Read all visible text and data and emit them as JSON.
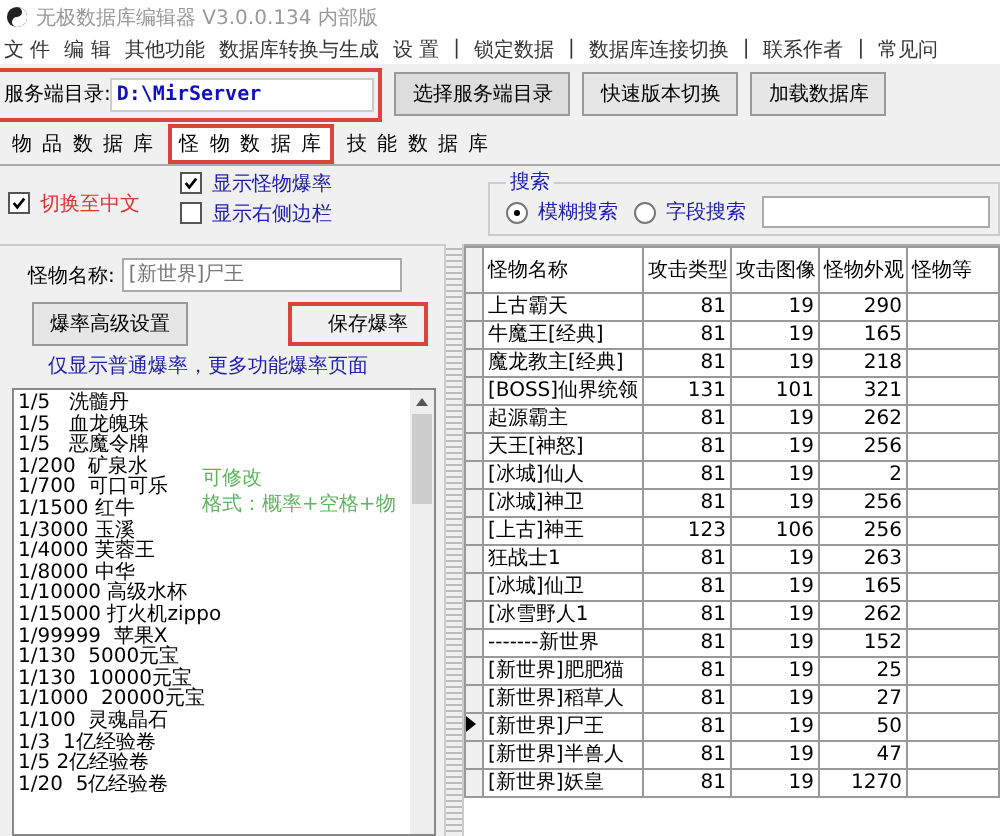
{
  "window": {
    "title": "无极数据库编辑器 V3.0.0.134 内部版"
  },
  "menu": [
    "文 件",
    "编 辑",
    "其他功能",
    "数据库转换与生成",
    "设 置",
    "|",
    "锁定数据",
    "|",
    "数据库连接切换",
    "|",
    "联系作者",
    "|",
    "常见问"
  ],
  "server": {
    "label": "服务端目录:",
    "value": "D:\\MirServer",
    "highlighted": true
  },
  "top_buttons": [
    "选择服务端目录",
    "快速版本切换",
    "加载数据库"
  ],
  "tabs": [
    {
      "label": "物 品 数 据 库",
      "selected": false,
      "highlighted": false
    },
    {
      "label": "怪 物 数 据 库",
      "selected": true,
      "highlighted": true
    },
    {
      "label": "技 能 数 据 库",
      "selected": false,
      "highlighted": false
    }
  ],
  "options": [
    {
      "label": "切换至中文",
      "checked": true
    },
    {
      "label": "显示怪物爆率",
      "checked": true
    },
    {
      "label": "显示右侧边栏",
      "checked": false
    }
  ],
  "search": {
    "legend": "搜索",
    "modes": [
      {
        "label": "模糊搜索",
        "selected": true
      },
      {
        "label": "字段搜索",
        "selected": false
      }
    ]
  },
  "monster_name": {
    "label": "怪物名称:",
    "value": "[新世界]尸王"
  },
  "drop_buttons": [
    {
      "label": "爆率高级设置",
      "highlighted": false
    },
    {
      "label": "保存爆率",
      "highlighted": true
    }
  ],
  "drop_link": "仅显示普通爆率，更多功能爆率页面",
  "drops": [
    "1/5   洗髓丹",
    "1/5   血龙魄珠",
    "1/5   恶魔令牌",
    "1/200  矿泉水",
    "1/700  可口可乐",
    "1/1500 红牛",
    "1/3000 玉溪",
    "1/4000 芙蓉王",
    "1/8000 中华",
    "1/10000 高级水杯",
    "1/15000 打火机zippo",
    "1/99999  苹果X",
    "1/130  5000元宝",
    "1/130  10000元宝",
    "1/1000  20000元宝",
    "1/100  灵魂晶石",
    "1/3  1亿经验卷",
    "1/5 2亿经验卷",
    "1/20  5亿经验卷"
  ],
  "hint": [
    "可修改",
    "格式：概率+空格+物"
  ],
  "table": {
    "columns": [
      "怪物名称",
      "攻击类型",
      "攻击图像",
      "怪物外观",
      "怪物等"
    ],
    "rows": [
      {
        "cells": [
          "上古霸天",
          "81",
          "19",
          "290"
        ],
        "selected": false
      },
      {
        "cells": [
          "牛魔王[经典]",
          "81",
          "19",
          "165"
        ],
        "selected": false
      },
      {
        "cells": [
          "魔龙教主[经典]",
          "81",
          "19",
          "218"
        ],
        "selected": false
      },
      {
        "cells": [
          "[BOSS]仙界统领",
          "131",
          "101",
          "321"
        ],
        "selected": false
      },
      {
        "cells": [
          "起源霸主",
          "81",
          "19",
          "262"
        ],
        "selected": false
      },
      {
        "cells": [
          "天王[神怒]",
          "81",
          "19",
          "256"
        ],
        "selected": false
      },
      {
        "cells": [
          "[冰城]仙人",
          "81",
          "19",
          "2"
        ],
        "selected": false
      },
      {
        "cells": [
          "[冰城]神卫",
          "81",
          "19",
          "256"
        ],
        "selected": false
      },
      {
        "cells": [
          "[上古]神王",
          "123",
          "106",
          "256"
        ],
        "selected": false
      },
      {
        "cells": [
          "狂战士1",
          "81",
          "19",
          "263"
        ],
        "selected": false
      },
      {
        "cells": [
          "[冰城]仙卫",
          "81",
          "19",
          "165"
        ],
        "selected": false
      },
      {
        "cells": [
          "[冰雪野人1",
          "81",
          "19",
          "262"
        ],
        "selected": false
      },
      {
        "cells": [
          "-------新世界",
          "81",
          "19",
          "152"
        ],
        "selected": false
      },
      {
        "cells": [
          "[新世界]肥肥猫",
          "81",
          "19",
          "25"
        ],
        "selected": false
      },
      {
        "cells": [
          "[新世界]稻草人",
          "81",
          "19",
          "27"
        ],
        "selected": false
      },
      {
        "cells": [
          "[新世界]尸王",
          "81",
          "19",
          "50"
        ],
        "selected": true
      },
      {
        "cells": [
          "[新世界]半兽人",
          "81",
          "19",
          "47"
        ],
        "selected": false
      },
      {
        "cells": [
          "[新世界]妖皇",
          "81",
          "19",
          "1270"
        ],
        "selected": false
      }
    ]
  }
}
